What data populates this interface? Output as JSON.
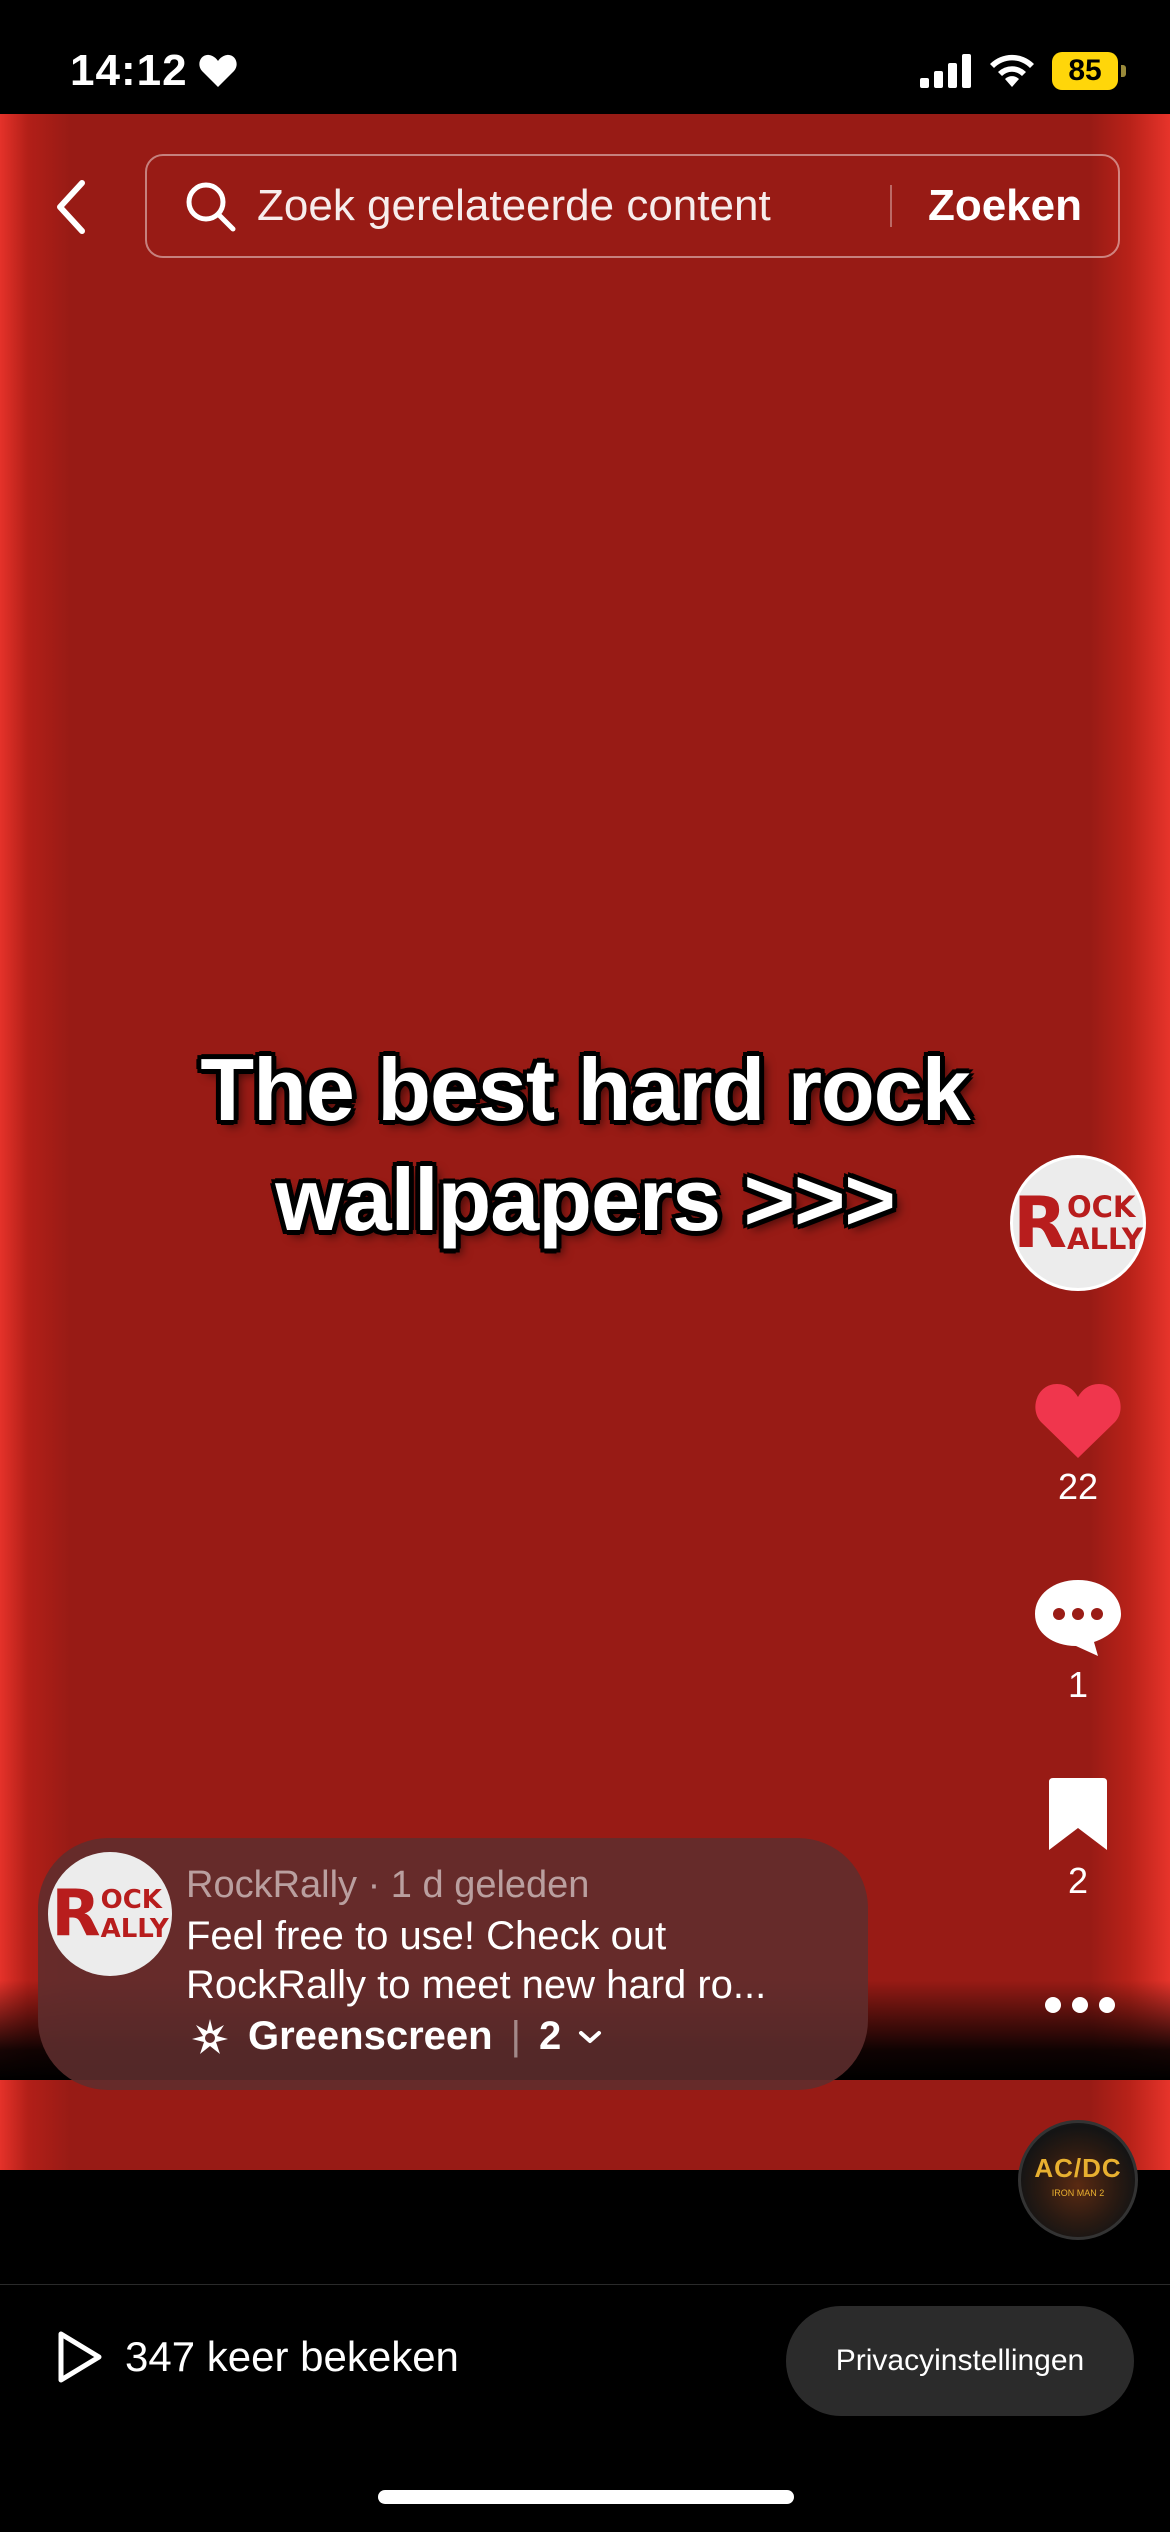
{
  "status_bar": {
    "time": "14:12",
    "battery": "85"
  },
  "search": {
    "placeholder": "Zoek gerelateerde content",
    "submit_label": "Zoeken"
  },
  "video": {
    "overlay_line1": "The best hard rock",
    "overlay_line2": "wallpapers >>>"
  },
  "creator": {
    "logo_text_top": "ROCK",
    "logo_text_bottom": "RALLY"
  },
  "actions": {
    "likes": "22",
    "comments": "1",
    "saves": "2"
  },
  "post": {
    "meta": "RockRally · 1 d geleden",
    "desc_line1": "Feel free to use! Check out",
    "desc_line2": "RockRally to meet new hard ro...",
    "effect_label": "Greenscreen",
    "tag_count": "2"
  },
  "sound": {
    "disc_title": "AC/DC",
    "disc_subtitle": "IRON MAN 2"
  },
  "footer": {
    "views": "347 keer bekeken",
    "privacy_button": "Privacyinstellingen"
  },
  "colors": {
    "video_red": "#981b15",
    "like_red": "#fe2c55",
    "battery_yellow": "#ffd60a"
  },
  "icons": [
    "heart-icon",
    "signal-icon",
    "wifi-icon",
    "battery-icon",
    "back-icon",
    "search-icon",
    "like-icon",
    "comment-icon",
    "bookmark-icon",
    "more-icon",
    "play-icon",
    "sparkle-icon",
    "chevron-down-icon"
  ]
}
